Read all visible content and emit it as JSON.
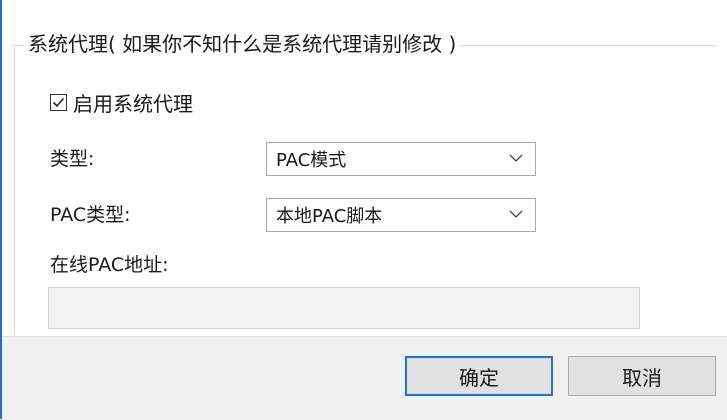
{
  "group": {
    "title": "系统代理( 如果你不知什么是系统代理请别修改 )"
  },
  "enable_proxy": {
    "label": "启用系统代理",
    "checked": true
  },
  "type_field": {
    "label": "类型:",
    "value": "PAC模式"
  },
  "pac_type_field": {
    "label": "PAC类型:",
    "value": "本地PAC脚本"
  },
  "pac_url_field": {
    "label": "在线PAC地址:",
    "value": ""
  },
  "buttons": {
    "ok": "确定",
    "cancel": "取消"
  },
  "colors": {
    "accent": "#1f72d6",
    "footer_bg": "#f0f0f0"
  }
}
